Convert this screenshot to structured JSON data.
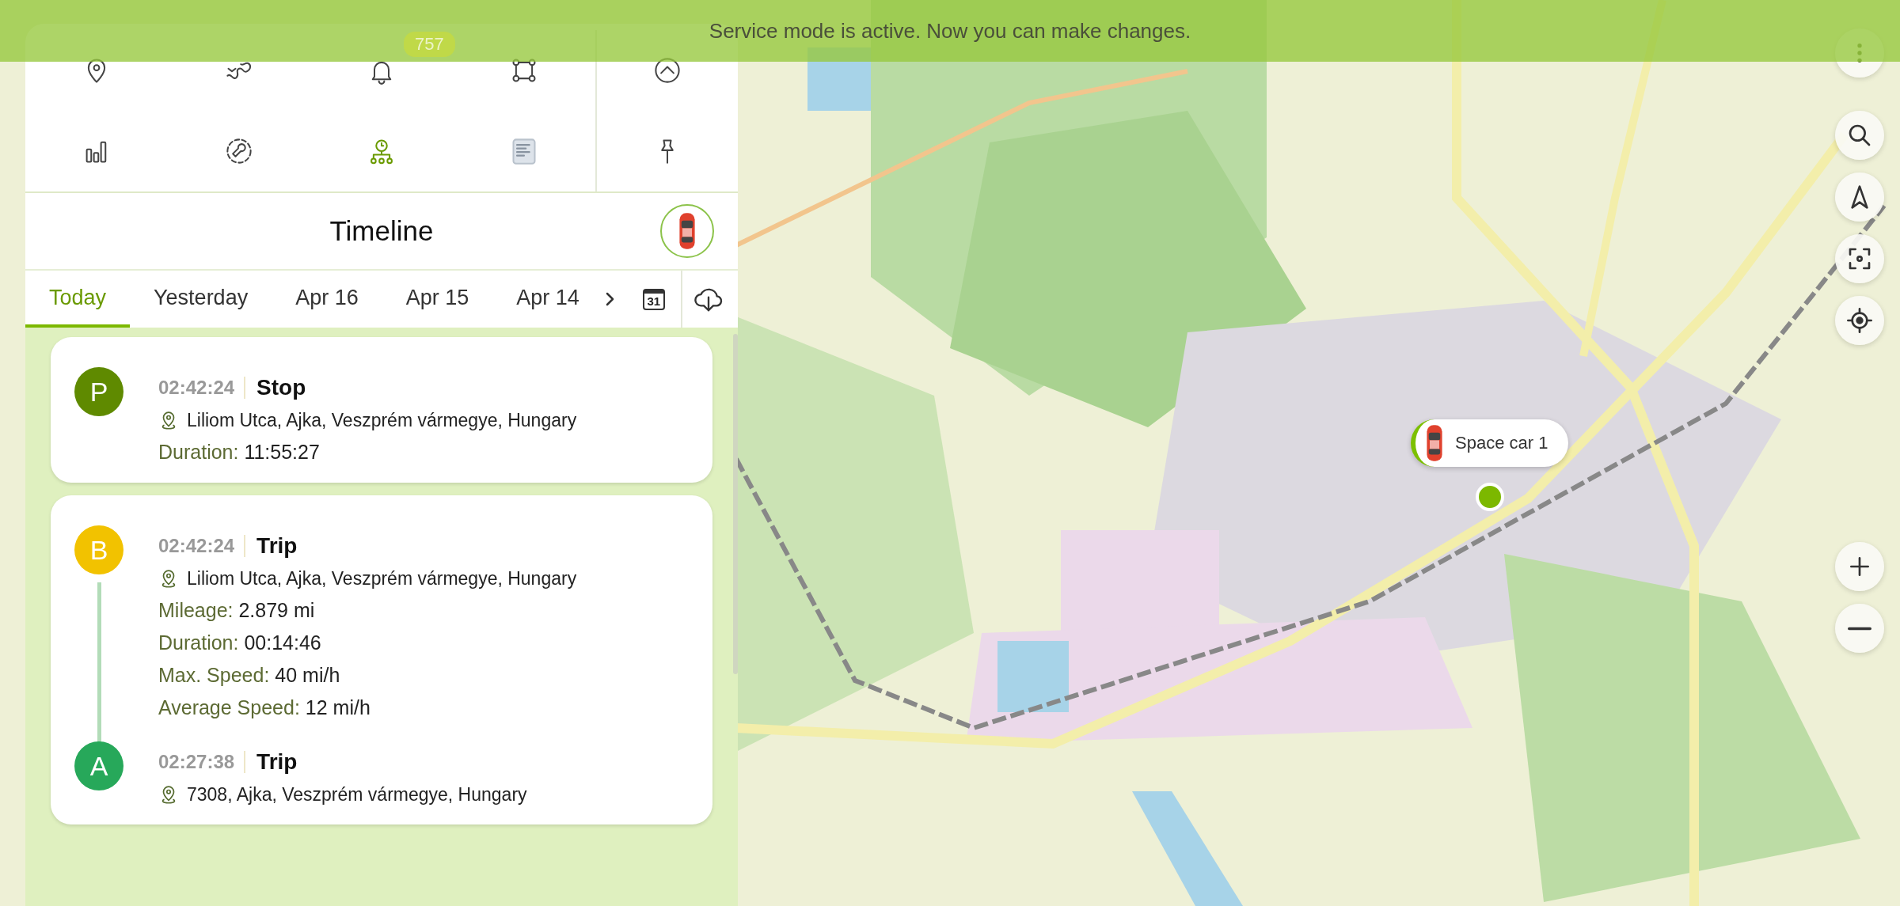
{
  "banner": {
    "text": "Service mode is active. Now you can make changes."
  },
  "badge": "757",
  "toolbar": [
    {
      "kind": "pin",
      "selected": false
    },
    {
      "kind": "route",
      "selected": false
    },
    {
      "kind": "bell",
      "selected": false
    },
    {
      "kind": "geofence",
      "selected": false
    },
    {
      "kind": "collapse",
      "selected": false
    },
    {
      "kind": "chart",
      "selected": false
    },
    {
      "kind": "service",
      "selected": false
    },
    {
      "kind": "timeline",
      "selected": true
    },
    {
      "kind": "report",
      "selected": false
    },
    {
      "kind": "pushpin",
      "selected": false
    }
  ],
  "title": "Timeline",
  "tabs": [
    {
      "label": "Today",
      "selected": true
    },
    {
      "label": "Yesterday",
      "selected": false
    },
    {
      "label": "Apr 16",
      "selected": false
    },
    {
      "label": "Apr 15",
      "selected": false
    },
    {
      "label": "Apr 14",
      "selected": false
    }
  ],
  "calendar_day": "31",
  "cards": [
    {
      "events": [
        {
          "marker": "P",
          "color": "#5f8a00",
          "time": "02:42:24",
          "type": "Stop",
          "address": "Liliom Utca, Ajka, Veszprém vármegye, Hungary",
          "details": [
            {
              "label": "Duration:",
              "value": "11:55:27"
            }
          ]
        }
      ]
    },
    {
      "events": [
        {
          "marker": "B",
          "color": "#f2c200",
          "time": "02:42:24",
          "type": "Trip",
          "address": "Liliom Utca, Ajka, Veszprém vármegye, Hungary",
          "details": [
            {
              "label": "Mileage:",
              "value": "2.879 mi"
            },
            {
              "label": "Duration:",
              "value": "00:14:46"
            },
            {
              "label": "Max. Speed:",
              "value": "40 mi/h"
            },
            {
              "label": "Average Speed:",
              "value": "12 mi/h"
            }
          ]
        },
        {
          "marker": "A",
          "color": "#27a85a",
          "time": "02:27:38",
          "type": "Trip",
          "address": "7308, Ajka, Veszprém vármegye, Hungary"
        }
      ]
    }
  ],
  "vehicle": {
    "label": "Space car 1"
  }
}
